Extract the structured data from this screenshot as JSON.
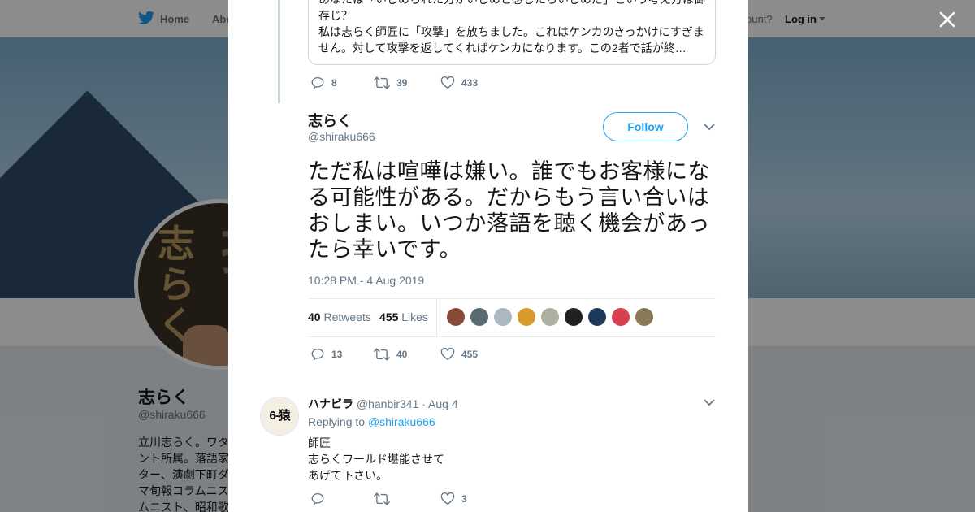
{
  "nav": {
    "home": "Home",
    "about_partial": "Abo",
    "account_partial": "ccount?",
    "login": "Log in"
  },
  "profile": {
    "name": "志らく",
    "handle": "@shiraku666",
    "bio_lines": [
      "立川志らく。ワタ",
      "ント所属。落語家",
      "ター、演劇下町ダ",
      "マ旬報コラムニス",
      "ムニスト、昭和歌"
    ]
  },
  "quoted": {
    "line1": "あなたは「いじめられた方がいじめと感じたらいじめだ」という考え方は御",
    "line2": "存じ？",
    "line3": "私は志らく師匠に「攻撃」を放ちました。これはケンカのきっかけにすぎま",
    "line4": "せん。対して攻撃を返してくればケンカになります。この2者で話が終…"
  },
  "prev_actions": {
    "replies": "8",
    "retweets": "39",
    "likes": "433"
  },
  "tweet": {
    "name": "志らく",
    "handle": "@shiraku666",
    "follow_label": "Follow",
    "text": "ただ私は喧嘩は嫌い。誰でもお客様になる可能性がある。だからもう言い合いはおしまい。いつか落語を聴く機会があったら幸いです。",
    "timestamp": "10:28 PM - 4 Aug 2019",
    "retweets_count": "40",
    "retweets_label": "Retweets",
    "likes_count": "455",
    "likes_label": "Likes",
    "actions": {
      "replies": "13",
      "retweets": "40",
      "likes": "455"
    }
  },
  "likers": [
    "#8a4a3a",
    "#5a6a72",
    "#aab8c2",
    "#d89a2a",
    "#b0b0a0",
    "#202020",
    "#1e3a5a",
    "#d84050",
    "#8a7a5a"
  ],
  "reply": {
    "avatar_text": "6-猿",
    "name": "ハナビラ",
    "handle": "@hanbir341",
    "date": "· Aug 4",
    "replying_prefix": "Replying to",
    "replying_to": "@shiraku666",
    "lines": [
      "師匠",
      "志らくワールド堪能させて",
      "あげて下さい。"
    ],
    "actions": {
      "replies": "",
      "retweets": "",
      "likes": "3"
    }
  },
  "colors": {
    "accent": "#1da1f2",
    "muted": "#657786",
    "overlay": "rgba(0,0,0,0.45)"
  }
}
